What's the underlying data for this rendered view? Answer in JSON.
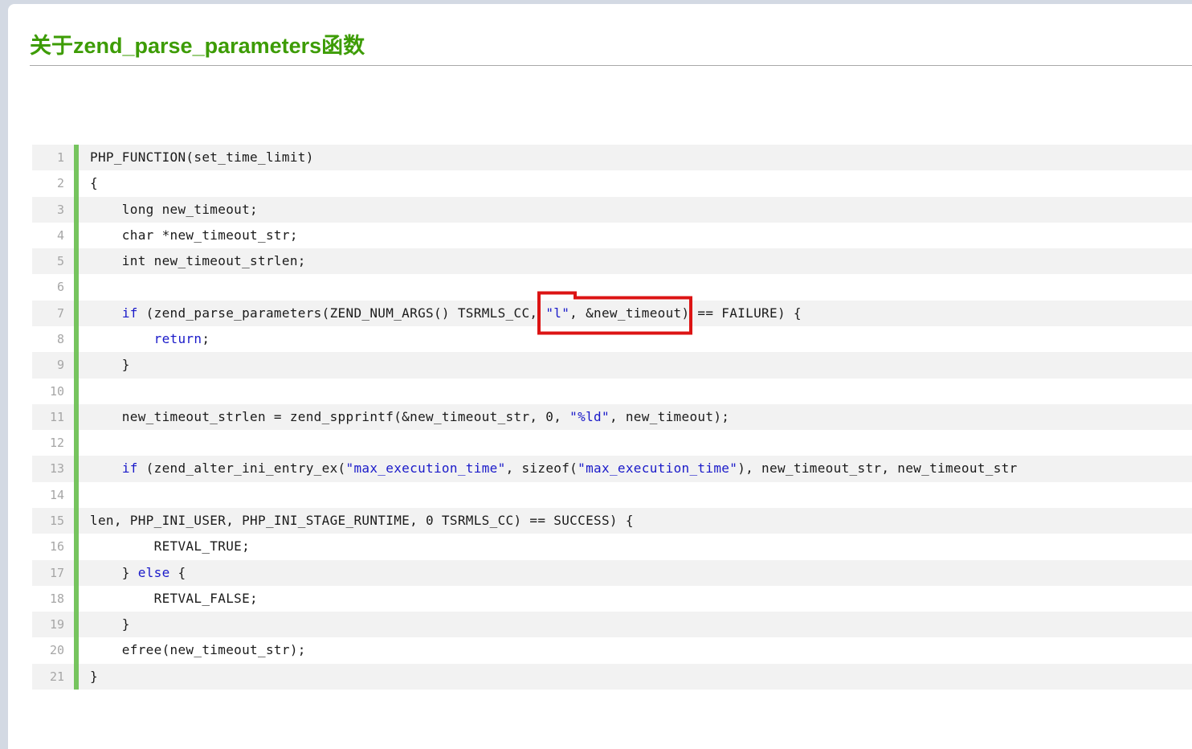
{
  "page": {
    "background": "#d3d9e3",
    "card_background": "#ffffff"
  },
  "article": {
    "title": "关于zend_parse_parameters函数",
    "title_color": "#3d9c05"
  },
  "code_block": {
    "stripe_color": "#f2f2f2",
    "gutter_bar_color": "#76c45e",
    "keyword_color": "#1a1ac9",
    "string_color": "#1a1ac9",
    "lines": [
      {
        "num": "1",
        "segments": [
          [
            "p",
            "PHP_FUNCTION(set_time_limit)"
          ]
        ]
      },
      {
        "num": "2",
        "segments": [
          [
            "p",
            "{"
          ]
        ]
      },
      {
        "num": "3",
        "segments": [
          [
            "p",
            "    long new_timeout;"
          ]
        ]
      },
      {
        "num": "4",
        "segments": [
          [
            "p",
            "    char *new_timeout_str;"
          ]
        ]
      },
      {
        "num": "5",
        "segments": [
          [
            "p",
            "    int new_timeout_strlen;"
          ]
        ]
      },
      {
        "num": "6",
        "segments": []
      },
      {
        "num": "7",
        "segments": [
          [
            "p",
            "    "
          ],
          [
            "k",
            "if"
          ],
          [
            "p",
            " (zend_parse_parameters(ZEND_NUM_ARGS() TSRMLS_CC, "
          ],
          [
            "s",
            "\"l\""
          ],
          [
            "p",
            ", &new_timeout) == FAILURE) {"
          ]
        ]
      },
      {
        "num": "8",
        "segments": [
          [
            "p",
            "        "
          ],
          [
            "k",
            "return"
          ],
          [
            "p",
            ";"
          ]
        ]
      },
      {
        "num": "9",
        "segments": [
          [
            "p",
            "    }"
          ]
        ]
      },
      {
        "num": "10",
        "segments": []
      },
      {
        "num": "11",
        "segments": [
          [
            "p",
            "    new_timeout_strlen = zend_spprintf(&new_timeout_str, 0, "
          ],
          [
            "s",
            "\"%ld\""
          ],
          [
            "p",
            ", new_timeout);"
          ]
        ]
      },
      {
        "num": "12",
        "segments": []
      },
      {
        "num": "13",
        "segments": [
          [
            "p",
            "    "
          ],
          [
            "k",
            "if"
          ],
          [
            "p",
            " (zend_alter_ini_entry_ex("
          ],
          [
            "s",
            "\"max_execution_time\""
          ],
          [
            "p",
            ", sizeof("
          ],
          [
            "s",
            "\"max_execution_time\""
          ],
          [
            "p",
            "), new_timeout_str, new_timeout_str"
          ]
        ]
      },
      {
        "num": "14",
        "segments": []
      },
      {
        "num": "15",
        "segments": [
          [
            "p",
            "len, PHP_INI_USER, PHP_INI_STAGE_RUNTIME, 0 TSRMLS_CC) == SUCCESS) {"
          ]
        ]
      },
      {
        "num": "16",
        "segments": [
          [
            "p",
            "        RETVAL_TRUE;"
          ]
        ]
      },
      {
        "num": "17",
        "segments": [
          [
            "p",
            "    } "
          ],
          [
            "k",
            "else"
          ],
          [
            "p",
            " {"
          ]
        ]
      },
      {
        "num": "18",
        "segments": [
          [
            "p",
            "        RETVAL_FALSE;"
          ]
        ]
      },
      {
        "num": "19",
        "segments": [
          [
            "p",
            "    }"
          ]
        ]
      },
      {
        "num": "20",
        "segments": [
          [
            "p",
            "    efree(new_timeout_str);"
          ]
        ]
      },
      {
        "num": "21",
        "segments": [
          [
            "p",
            "}"
          ]
        ]
      }
    ]
  },
  "annotation_box": {
    "color": "#dc1414",
    "highlighted_text": "\"l\", &new_timeout)"
  }
}
